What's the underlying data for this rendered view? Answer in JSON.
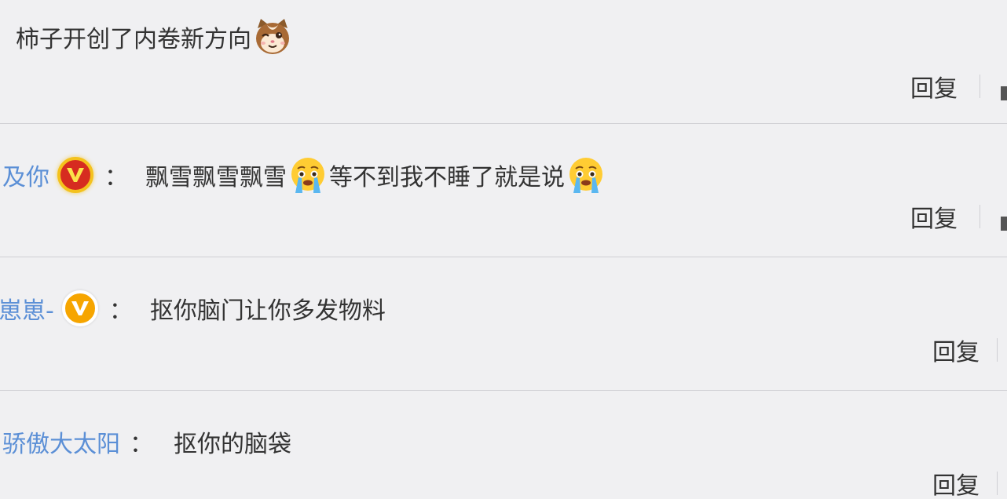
{
  "comments": [
    {
      "username": "",
      "badge": null,
      "segments": [
        "柿子开创了内卷新方向"
      ],
      "trailing_emoji": "cat-face-emoji",
      "reply_label": "回复"
    },
    {
      "username": "及你",
      "badge": "red-v-badge",
      "colon": "：",
      "segments": [
        "飘雪飘雪飘雪",
        "等不到我不睡了就是说"
      ],
      "emojis": [
        "crying-face-emoji",
        "crying-face-emoji"
      ],
      "reply_label": "回复"
    },
    {
      "username": "崽崽-",
      "badge": "gold-v-badge",
      "colon": "：",
      "segments": [
        "抠你脑门让你多发物料"
      ],
      "reply_label": "回复"
    },
    {
      "username": "骄傲大太阳",
      "badge": null,
      "colon": "：",
      "segments": [
        "抠你的脑袋"
      ],
      "reply_label": "回复"
    }
  ],
  "colors": {
    "background": "#f0f0f2",
    "username": "#5b8fd6",
    "text": "#333333",
    "divider": "#cfcfd3",
    "red_badge": "#d62b20",
    "gold_badge": "#f6a500"
  }
}
